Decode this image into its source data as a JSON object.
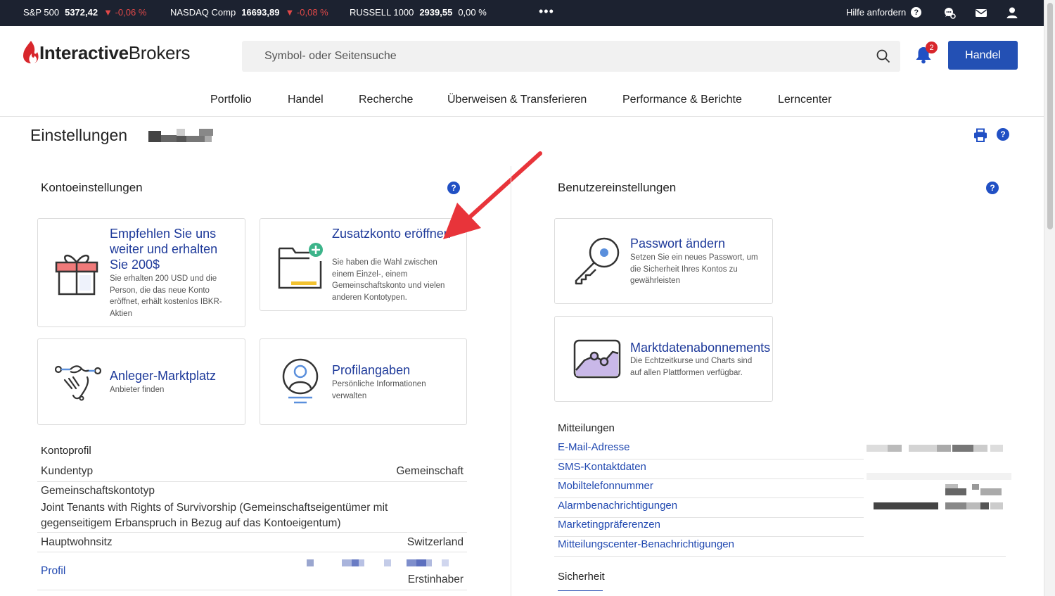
{
  "ticker": {
    "items": [
      {
        "name": "S&P 500",
        "value": "5372,42",
        "change": "-0,06 %"
      },
      {
        "name": "NASDAQ Comp",
        "value": "16693,89",
        "change": "-0,08 %"
      },
      {
        "name": "RUSSELL 1000",
        "value": "2939,55",
        "change": "0,00 %"
      }
    ],
    "more": "•••",
    "help_label": "Hilfe anfordern",
    "help_q": "?"
  },
  "header": {
    "logo_bold": "Interactive",
    "logo_light": "Brokers",
    "search_placeholder": "Symbol- oder Seitensuche",
    "notifications_count": "2",
    "trade_button": "Handel"
  },
  "nav": {
    "items": [
      "Portfolio",
      "Handel",
      "Recherche",
      "Überweisen & Transferieren",
      "Performance & Berichte",
      "Lerncenter"
    ]
  },
  "page": {
    "title": "Einstellungen",
    "help_q": "?"
  },
  "account_settings": {
    "heading": "Kontoeinstellungen",
    "cards": [
      {
        "title": "Empfehlen Sie uns weiter und erhalten Sie 200$",
        "desc": "Sie erhalten 200 USD und die Person, die das neue Konto eröffnet, erhält kostenlos IBKR-Aktien"
      },
      {
        "title": "Zusatzkonto eröffnen",
        "desc": "Sie haben die Wahl zwischen einem Einzel-, einem Gemeinschaftskonto und vielen anderen Kontotypen."
      },
      {
        "title": "Anleger-Marktplatz",
        "desc": "Anbieter finden"
      },
      {
        "title": "Profilangaben",
        "desc": "Persönliche Informationen verwalten"
      }
    ]
  },
  "account_profile": {
    "heading": "Kontoprofil",
    "client_type_label": "Kundentyp",
    "client_type_value": "Gemeinschaft",
    "joint_type_label": "Gemeinschaftskontotyp",
    "joint_type_value": "Joint Tenants with Rights of Survivorship (Gemeinschaftseigentümer mit gegenseitigem Erbanspruch in Bezug auf das Kontoeigentum)",
    "residence_label": "Hauptwohnsitz",
    "residence_value": "Switzerland",
    "profile_link": "Profil",
    "profile_role": "Erstinhaber"
  },
  "user_settings": {
    "heading": "Benutzereinstellungen",
    "cards": [
      {
        "title": "Passwort ändern",
        "desc": "Setzen Sie ein neues Passwort, um die Sicherheit Ihres Kontos zu gewährleisten"
      },
      {
        "title": "Marktdatenabonnements",
        "desc": "Die Echtzeitkurse und Charts sind auf allen Plattformen verfügbar."
      }
    ]
  },
  "communications": {
    "heading": "Mitteilungen",
    "items": [
      "E-Mail-Adresse",
      "SMS-Kontaktdaten",
      "Mobiltelefonnummer",
      "Alarmbenachrichtigungen",
      "Marketingpräferenzen",
      "Mitteilungscenter-Benachrichtigungen"
    ]
  },
  "security": {
    "heading": "Sicherheit"
  },
  "colors": {
    "ticker_bg": "#1c2230",
    "link_blue": "#2048b0",
    "card_title": "#1e3a9a",
    "primary_button": "#2350b4",
    "negative": "#e04848",
    "annotation_arrow": "#e8343a"
  }
}
